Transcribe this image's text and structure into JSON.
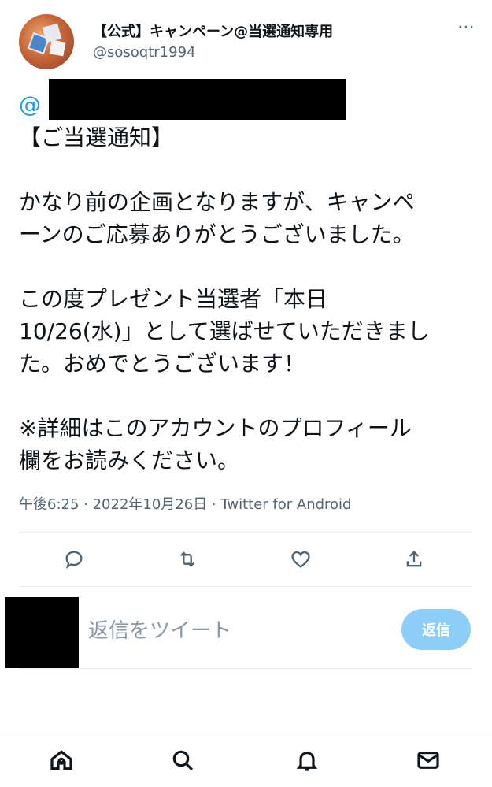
{
  "tweet": {
    "author": {
      "display_name": "【公式】キャンペーン@当選通知専用",
      "handle": "@sosoqtr1994"
    },
    "mention_at": "@",
    "lines": [
      "【ご当選通知】",
      "",
      "かなり前の企画となりますが、キャンペ",
      "ーンのご応募ありがとうございました。",
      "",
      "この度プレゼント当選者「本日",
      "10/26(水)」として選ばせていただきまし",
      "た。おめでとうございます！",
      "",
      "※詳細はこのアカウントのプロフィール",
      "欄をお読みください。"
    ],
    "meta": "午後6:25 · 2022年10月26日 · Twitter for Android"
  },
  "more_icon": "⋯",
  "actions": [
    {
      "name": "reply-icon"
    },
    {
      "name": "retweet-icon"
    },
    {
      "name": "like-icon"
    },
    {
      "name": "share-icon"
    }
  ],
  "reply": {
    "placeholder": "返信をツイート",
    "button_label": "返信"
  },
  "bottom_nav": [
    "home-icon",
    "search-icon",
    "notifications-icon",
    "messages-icon"
  ],
  "colors": {
    "accent": "#1d9bf0",
    "reply_button_disabled": "#8ecdf7",
    "secondary_text": "#536471"
  }
}
